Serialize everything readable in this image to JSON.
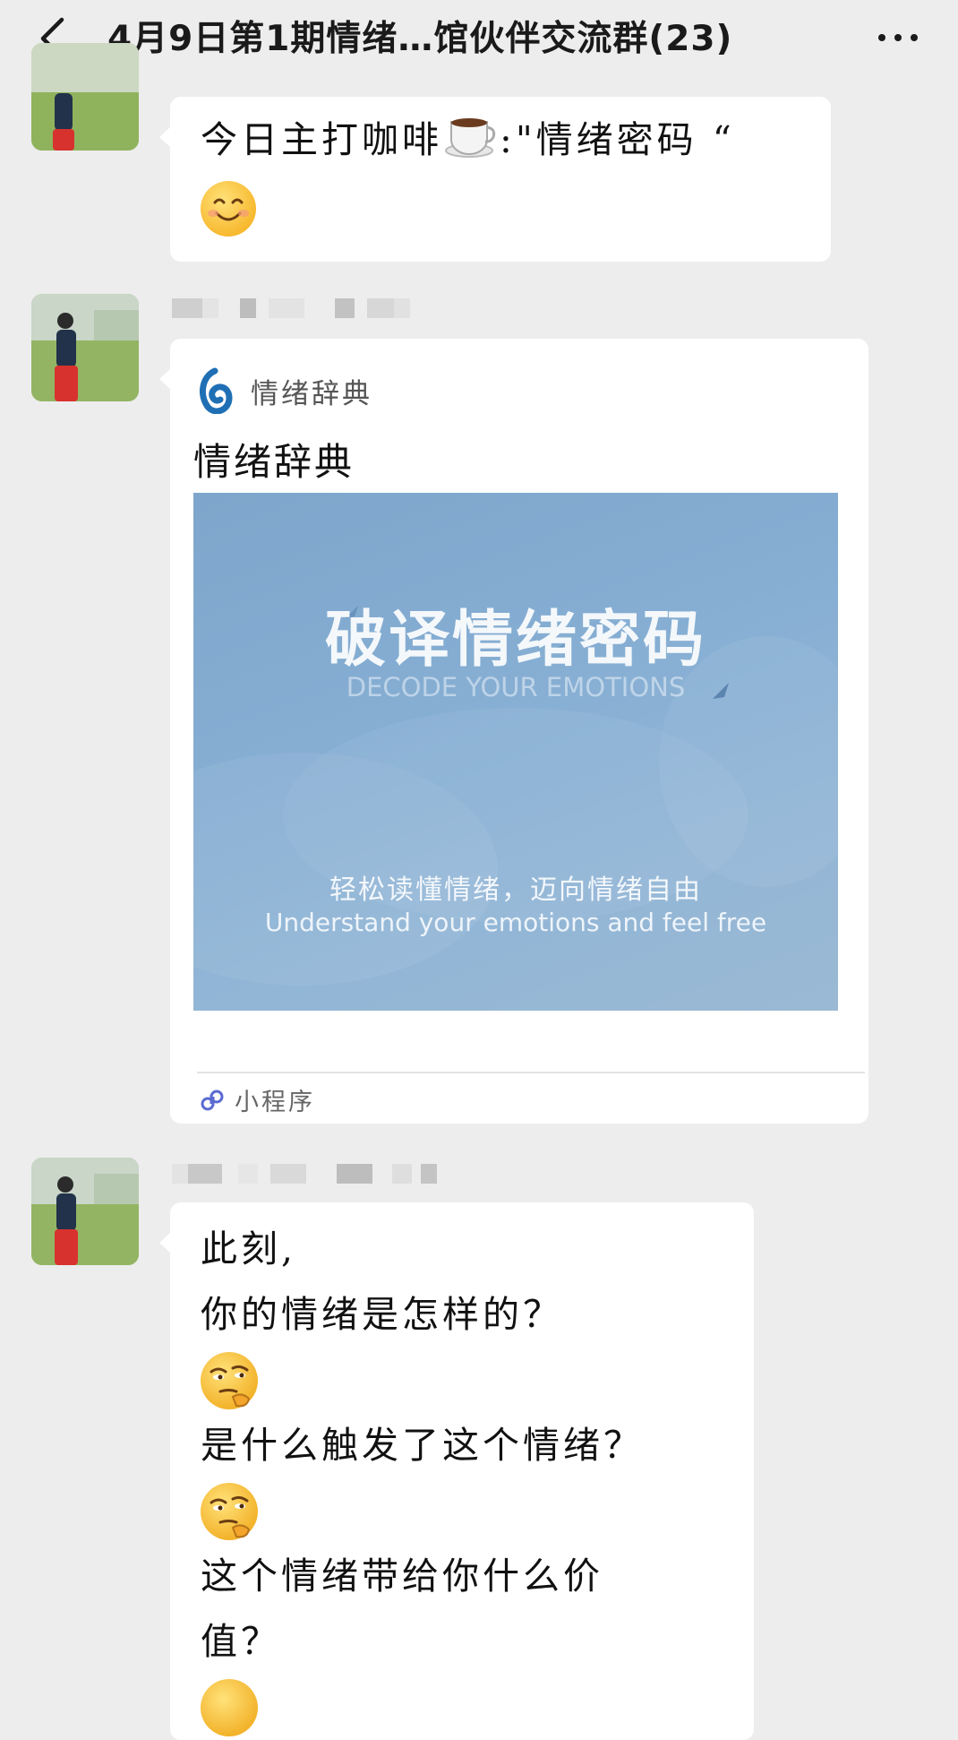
{
  "header": {
    "title": "4月9日第1期情绪…馆伙伴交流群(23)"
  },
  "messages": [
    {
      "type": "text",
      "line1": "今日主打咖啡",
      "line1_suffix": ":\"情绪密码 “",
      "emoji_inline": "coffee-emoji",
      "emoji_line2": "smile-emoji"
    },
    {
      "type": "mini_program",
      "brand_name": "情绪辞典",
      "title": "情绪辞典",
      "cover": {
        "headline": "破译情绪密码",
        "headline_en": "DECODE YOUR EMOTIONS",
        "tagline_cn": "轻松读懂情绪，迈向情绪自由",
        "tagline_en": "Understand your emotions and feel free"
      },
      "footer_label": "小程序"
    },
    {
      "type": "text",
      "lines": [
        "此刻,",
        "你的情绪是怎样的？",
        "是什么触发了这个情绪？",
        "这个情绪带给你什么价",
        "值？"
      ]
    }
  ],
  "colors": {
    "chat_background": "#ededed",
    "bubble": "#ffffff",
    "cover_blue": "#86aed3",
    "brand_blue": "#1f6fb5"
  }
}
